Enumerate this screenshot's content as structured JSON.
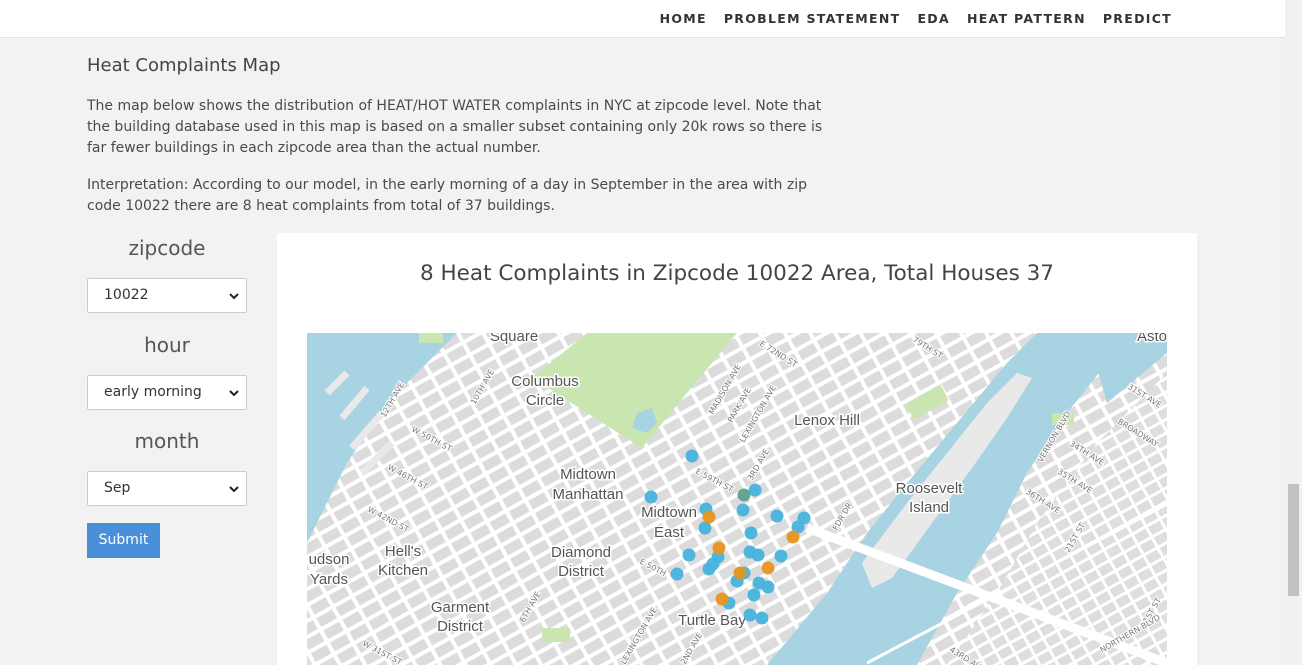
{
  "nav": {
    "items": [
      "HOME",
      "PROBLEM STATEMENT",
      "EDA",
      "HEAT PATTERN",
      "PREDICT"
    ]
  },
  "section": {
    "title": "Heat Complaints Map",
    "paragraph1": "The map below shows the distribution of HEAT/HOT WATER complaints in NYC at zipcode level. Note that the building database used in this map is based on a smaller subset containing only 20k rows so there is far fewer buildings in each zipcode area than the actual number.",
    "paragraph2": "Interpretation: According to our model, in the early morning of a day in September in the area with zip code 10022 there are 8 heat complaints from total of 37 buildings."
  },
  "form": {
    "zipcode_label": "zipcode",
    "zipcode_value": "10022",
    "hour_label": "hour",
    "hour_value": "early morning",
    "month_label": "month",
    "month_value": "Sep",
    "submit_label": "Submit"
  },
  "map": {
    "title": "8 Heat Complaints in Zipcode 10022 Area, Total Houses 37",
    "place_labels": [
      "Square",
      "Columbus",
      "Circle",
      "Lenox Hill",
      "Midtown",
      "Manhattan",
      "Midtown",
      "East",
      "Roosevelt",
      "Island",
      "udson",
      "Yards",
      "Hell's",
      "Kitchen",
      "Diamond",
      "District",
      "Garment",
      "District",
      "Turtle Bay",
      "Asto"
    ],
    "street_labels": [
      "E 72ND ST",
      "79TH ST",
      "12TH AVE",
      "10TH AVE",
      "MADISON AVE",
      "PARK AVE",
      "LEXINGTON AVE",
      "W 50TH ST",
      "W 46TH ST",
      "W 42ND ST",
      "E 59TH ST",
      "3RD AVE",
      "FDR DR",
      "E 50TH",
      "6TH AVE",
      "W 31ST ST",
      "LEXINGTON AVE",
      "2ND AVE",
      "VERNON BLVD",
      "34TH AVE",
      "35TH AVE",
      "36TH AVE",
      "31ST AVE",
      "BROADWAY",
      "21ST ST",
      "31ST ST",
      "NORTHERN BLVD",
      "43RD AVE"
    ],
    "colors": {
      "water": "#a8d3e3",
      "park": "#c9e6b0",
      "land": "#e9e9e9",
      "building": "#d9d9d9",
      "road": "#ffffff",
      "no_complaint_marker": "#46b3dc",
      "complaint_marker": "#e6951f"
    }
  }
}
